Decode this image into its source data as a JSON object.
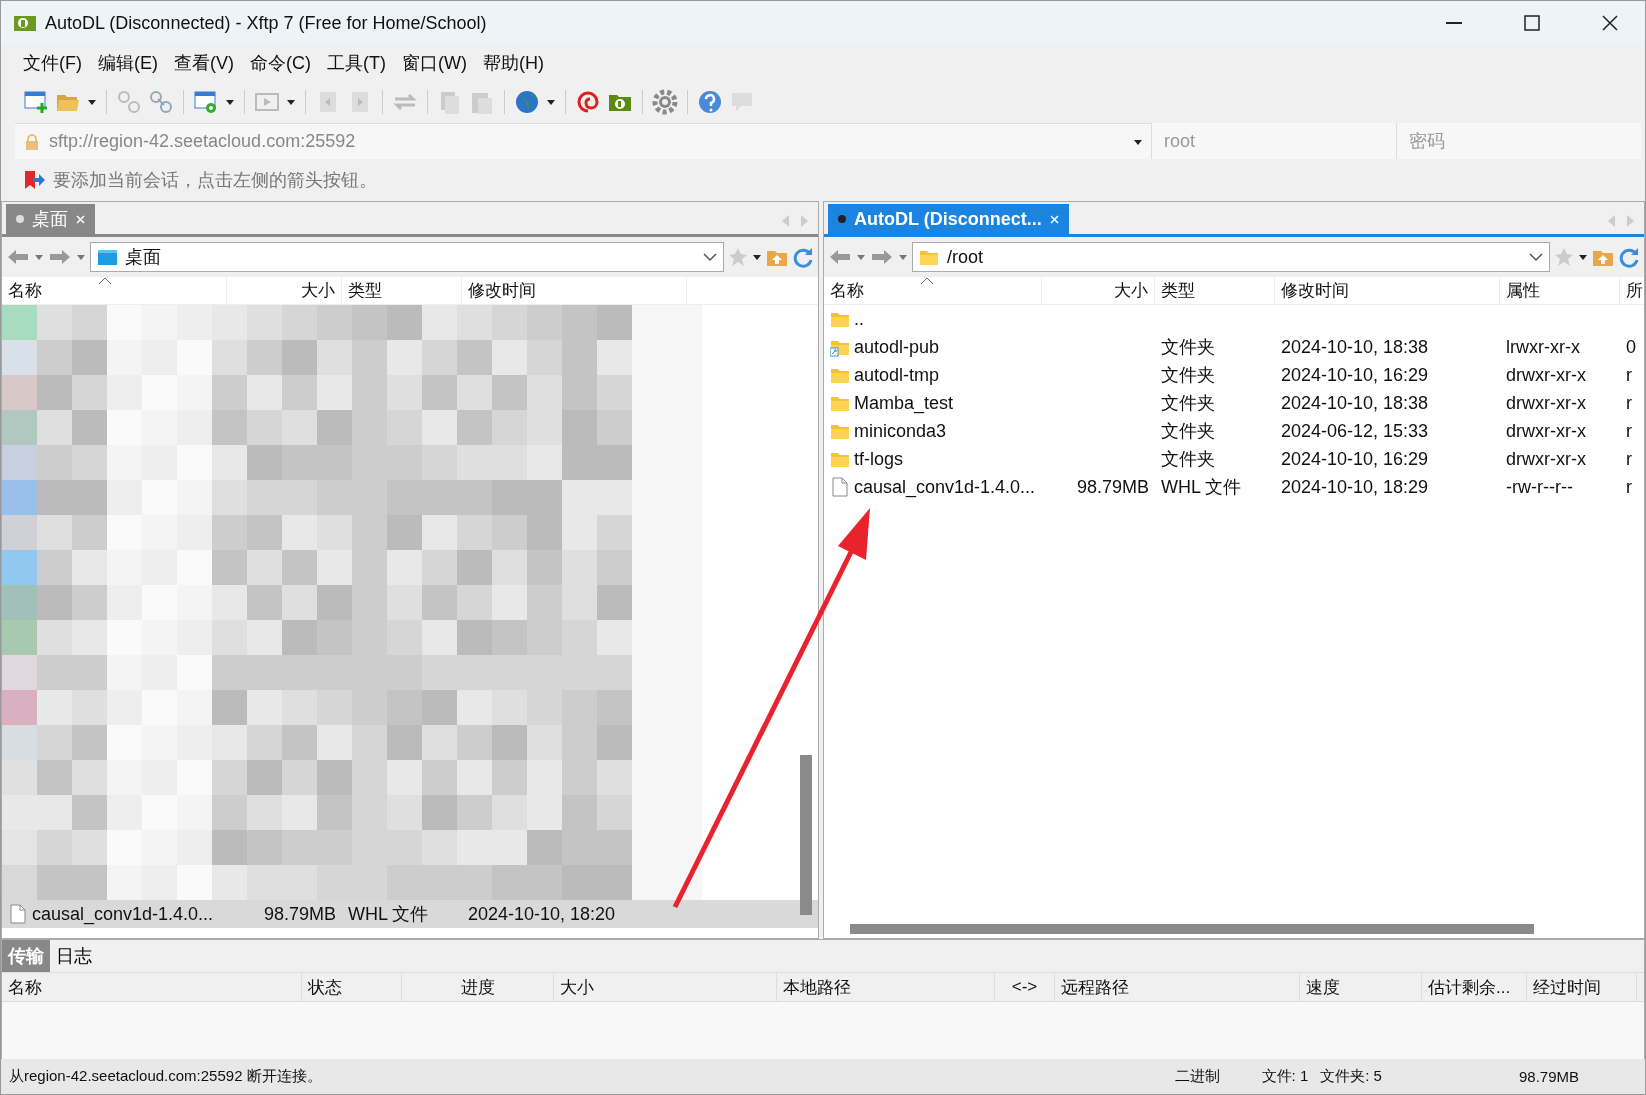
{
  "window": {
    "title": "AutoDL (Disconnected) - Xftp 7 (Free for Home/School)"
  },
  "menu": [
    "文件(F)",
    "编辑(E)",
    "查看(V)",
    "命令(C)",
    "工具(T)",
    "窗口(W)",
    "帮助(H)"
  ],
  "address_bar": {
    "value": "sftp://region-42.seetacloud.com:25592",
    "user": "root",
    "password_placeholder": "密码"
  },
  "hint": "要添加当前会话，点击左侧的箭头按钮。",
  "left_pane": {
    "active": false,
    "tabs": [
      {
        "label": "桌面",
        "selected": true
      }
    ],
    "path": {
      "text": "桌面",
      "kind": "desktop"
    },
    "columns": [
      "名称",
      "大小",
      "类型",
      "修改时间"
    ],
    "rows": [
      {
        "kind": "file",
        "name": "causal_conv1d-1.4.0...",
        "size": "98.79MB",
        "type": "WHL 文件",
        "modified": "2024-10-10, 18:20",
        "selected": true
      }
    ]
  },
  "right_pane": {
    "active": true,
    "tabs": [
      {
        "label": "AutoDL (Disconnect...",
        "selected": true
      }
    ],
    "path": {
      "text": "/root",
      "kind": "folder"
    },
    "columns": [
      "名称",
      "大小",
      "类型",
      "修改时间",
      "属性",
      "所"
    ],
    "rows": [
      {
        "kind": "parent",
        "name": "..",
        "selected": false
      },
      {
        "kind": "link",
        "name": "autodl-pub",
        "type": "文件夹",
        "modified": "2024-10-10, 18:38",
        "attributes": "lrwxr-xr-x",
        "owner": "0",
        "selected": false
      },
      {
        "kind": "folder",
        "name": "autodl-tmp",
        "type": "文件夹",
        "modified": "2024-10-10, 16:29",
        "attributes": "drwxr-xr-x",
        "owner": "r",
        "selected": false
      },
      {
        "kind": "folder",
        "name": "Mamba_test",
        "type": "文件夹",
        "modified": "2024-10-10, 18:38",
        "attributes": "drwxr-xr-x",
        "owner": "r",
        "selected": false
      },
      {
        "kind": "folder",
        "name": "miniconda3",
        "type": "文件夹",
        "modified": "2024-06-12, 15:33",
        "attributes": "drwxr-xr-x",
        "owner": "r",
        "selected": false
      },
      {
        "kind": "folder",
        "name": "tf-logs",
        "type": "文件夹",
        "modified": "2024-10-10, 16:29",
        "attributes": "drwxr-xr-x",
        "owner": "r",
        "selected": false
      },
      {
        "kind": "file",
        "name": "causal_conv1d-1.4.0...",
        "size": "98.79MB",
        "type": "WHL 文件",
        "modified": "2024-10-10, 18:29",
        "attributes": "-rw-r--r--",
        "owner": "r",
        "selected": false
      }
    ]
  },
  "transfer": {
    "tabs": [
      {
        "label": "传输",
        "selected": true
      },
      {
        "label": "日志",
        "selected": false
      }
    ],
    "columns": [
      "名称",
      "状态",
      "进度",
      "大小",
      "本地路径",
      "<->",
      "远程路径",
      "速度",
      "估计剩余...",
      "经过时间"
    ]
  },
  "status_bar": {
    "message": "从region-42.seetacloud.com:25592 断开连接。",
    "mode": "二进制",
    "files": "文件: 1",
    "folders": "文件夹: 5",
    "size": "98.79MB"
  }
}
